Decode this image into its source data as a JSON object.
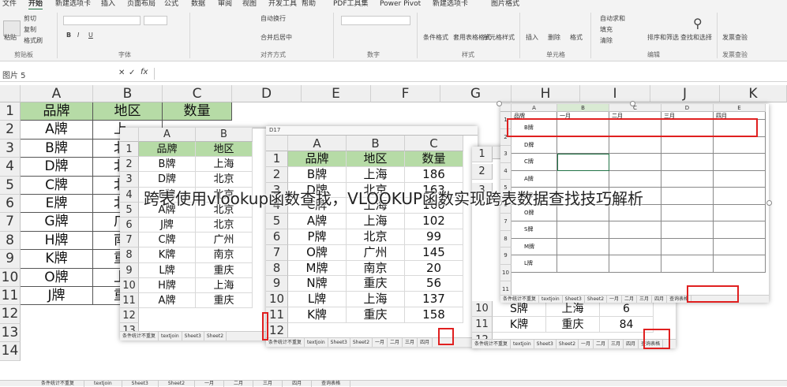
{
  "ribbon": {
    "tabs": [
      "文件",
      "开始",
      "新建选项卡",
      "插入",
      "页面布局",
      "公式",
      "数据",
      "审阅",
      "视图",
      "开发工具",
      "帮助",
      "PDF工具集",
      "Power Pivot",
      "新建选项卡",
      "图片格式"
    ],
    "buttons": {
      "paste": "粘贴",
      "cut": "剪切",
      "copy": "复制",
      "format_painter": "格式刷",
      "wrap": "自动换行",
      "merge": "合并后居中",
      "conditional": "条件格式",
      "table_format": "套用表格格式",
      "cell_style": "单元格样式",
      "insert": "插入",
      "delete": "删除",
      "format": "格式",
      "autosum": "自动求和",
      "fill": "填充",
      "clear": "清除",
      "sort": "排序和筛选",
      "find": "查找和选择",
      "send": "发票查验"
    },
    "groups": [
      "剪贴板",
      "字体",
      "对齐方式",
      "数字",
      "样式",
      "单元格",
      "编辑",
      "发票查验"
    ]
  },
  "formula_bar": {
    "name_box": "图片 5",
    "fx": "fx"
  },
  "main_sheet": {
    "columns": [
      "A",
      "B",
      "C",
      "D",
      "E",
      "F",
      "G",
      "H",
      "I",
      "J",
      "K"
    ],
    "rows": [
      "1",
      "2",
      "3",
      "4",
      "5",
      "6",
      "7",
      "8",
      "9",
      "10",
      "11",
      "12",
      "13",
      "14"
    ],
    "header": [
      "品牌",
      "地区",
      "数量"
    ],
    "col_a": [
      "A牌",
      "B牌",
      "D牌",
      "C牌",
      "E牌",
      "G牌",
      "H牌",
      "K牌",
      "O牌",
      "J牌"
    ],
    "col_b": [
      "上",
      "北",
      "北",
      "北",
      "北",
      "广",
      "南",
      "重",
      "上",
      "重"
    ],
    "tabs": [
      "条件统计不重复",
      "textjoin",
      "Sheet3",
      "Sheet2"
    ]
  },
  "sheet2": {
    "columns": [
      "A",
      "B"
    ],
    "rows": [
      "1",
      "2",
      "3",
      "4",
      "5",
      "6",
      "7",
      "8",
      "9",
      "10",
      "11",
      "12",
      "13"
    ],
    "header": [
      "品牌",
      "地区"
    ],
    "data": [
      [
        "B牌",
        "上海"
      ],
      [
        "D牌",
        "北京"
      ],
      [
        "E牌",
        "北京"
      ],
      [
        "A牌",
        "北京"
      ],
      [
        "J牌",
        "北京"
      ],
      [
        "C牌",
        "广州"
      ],
      [
        "K牌",
        "南京"
      ],
      [
        "L牌",
        "重庆"
      ],
      [
        "H牌",
        "上海"
      ],
      [
        "A牌",
        "重庆"
      ]
    ],
    "tabs": [
      "条件统计不重复",
      "textjoin",
      "Sheet3",
      "Sheet2"
    ]
  },
  "sheet3": {
    "name_box": "D17",
    "columns": [
      "A",
      "B",
      "C"
    ],
    "rows": [
      "1",
      "2",
      "3",
      "4",
      "5",
      "6",
      "7",
      "8",
      "9",
      "10",
      "11",
      "12"
    ],
    "header": [
      "品牌",
      "地区",
      "数量"
    ],
    "data": [
      [
        "B牌",
        "上海",
        "186"
      ],
      [
        "D牌",
        "北京",
        "163"
      ],
      [
        "C牌",
        "上海",
        "160"
      ],
      [
        "A牌",
        "上海",
        "102"
      ],
      [
        "P牌",
        "北京",
        "99"
      ],
      [
        "O牌",
        "广州",
        "145"
      ],
      [
        "M牌",
        "南京",
        "20"
      ],
      [
        "N牌",
        "重庆",
        "56"
      ],
      [
        "L牌",
        "上海",
        "137"
      ],
      [
        "K牌",
        "重庆",
        "158"
      ]
    ],
    "tabs": [
      "条件统计不重复",
      "textjoin",
      "Sheet3",
      "Sheet2",
      "一月",
      "二月",
      "三月",
      "四月"
    ]
  },
  "sheet4": {
    "rows_visible": [
      "1",
      "2",
      "3",
      "10",
      "11",
      "12"
    ],
    "tail": [
      [
        "S牌",
        "上海",
        "6"
      ],
      [
        "K牌",
        "重庆",
        "84"
      ]
    ],
    "tabs": [
      "条件统计不重复",
      "textjoin",
      "Sheet3",
      "Sheet2",
      "一月",
      "二月",
      "三月",
      "四月",
      "查询表格"
    ]
  },
  "sheet5": {
    "columns": [
      "A",
      "B",
      "C",
      "D",
      "E"
    ],
    "rows": [
      "1",
      "2",
      "3",
      "4",
      "5",
      "6",
      "7",
      "8",
      "9",
      "10",
      "11"
    ],
    "header": [
      "品牌",
      "一月",
      "二月",
      "三月",
      "四月"
    ],
    "brands": [
      "B牌",
      "D牌",
      "C牌",
      "A牌",
      "P牌",
      "O牌",
      "S牌",
      "M牌",
      "L牌"
    ],
    "tabs": [
      "条件统计不重复",
      "textjoin",
      "Sheet3",
      "Sheet2",
      "一月",
      "二月",
      "三月",
      "四月",
      "查询表格"
    ]
  },
  "bottom_tabs": [
    "条件统计不重复",
    "textjoin",
    "Sheet3",
    "Sheet2",
    "一月",
    "二月",
    "三月",
    "四月",
    "查询表格"
  ],
  "overlay_text": "跨表使用vlookup函数查找，VLOOKUP函数实现跨表数据查找技巧解析"
}
